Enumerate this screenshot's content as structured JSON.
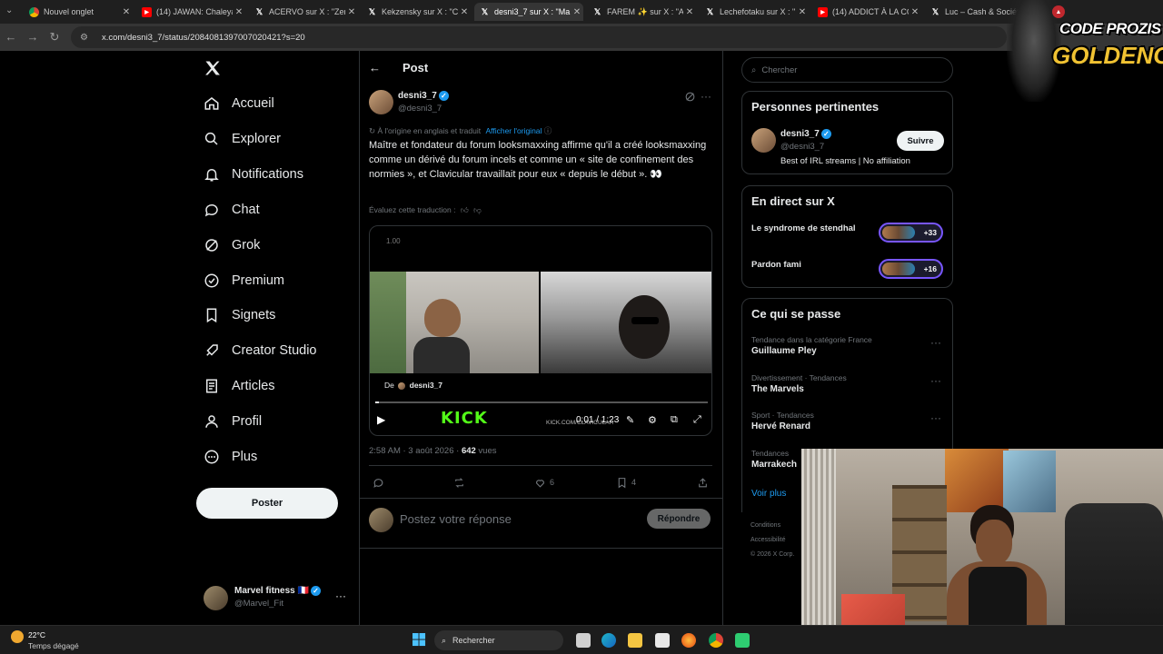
{
  "browser": {
    "tabs": [
      {
        "title": "Nouvel onglet",
        "icon": "chrome-icon",
        "active": false
      },
      {
        "title": "(14) JAWAN: Chaleya",
        "icon": "youtube-icon",
        "active": false
      },
      {
        "title": "ACERVO sur X : \"Zen",
        "icon": "x-icon",
        "active": false
      },
      {
        "title": "Kekzensky sur X : \"Cli",
        "icon": "x-icon",
        "active": false
      },
      {
        "title": "desni3_7 sur X : \"Ma",
        "icon": "x-icon",
        "active": true
      },
      {
        "title": "FAREM ✨ sur X : \"Aj",
        "icon": "x-icon",
        "active": false
      },
      {
        "title": "Lechefotaku sur X : \"",
        "icon": "x-icon",
        "active": false
      },
      {
        "title": "(14) ADDICT À LA CO",
        "icon": "youtube-icon",
        "active": false
      },
      {
        "title": "Luc – Cash & Sociét",
        "icon": "x-icon",
        "active": false
      }
    ],
    "url": "x.com/desni3_7/status/2084081397007020421?s=20"
  },
  "sidebar": {
    "items": [
      {
        "label": "Accueil",
        "icon": "home-icon"
      },
      {
        "label": "Explorer",
        "icon": "search-icon"
      },
      {
        "label": "Notifications",
        "icon": "bell-icon"
      },
      {
        "label": "Chat",
        "icon": "chat-bubble-icon"
      },
      {
        "label": "Grok",
        "icon": "grok-icon"
      },
      {
        "label": "Premium",
        "icon": "verified-badge-icon"
      },
      {
        "label": "Signets",
        "icon": "bookmark-icon"
      },
      {
        "label": "Creator Studio",
        "icon": "rocket-icon"
      },
      {
        "label": "Articles",
        "icon": "article-icon"
      },
      {
        "label": "Profil",
        "icon": "person-icon"
      },
      {
        "label": "Plus",
        "icon": "more-circle-icon"
      }
    ],
    "post_label": "Poster",
    "account": {
      "name": "Marvel fitness 🇫🇷",
      "handle": "@Marvel_Fit",
      "more": "···"
    }
  },
  "post": {
    "header": "Post",
    "author": {
      "name": "desni3_7",
      "handle": "@desni3_7"
    },
    "translated_note": "À l'origine en anglais et traduit",
    "show_original": "Afficher l'original",
    "text": "Maître et fondateur du forum looksmaxxing affirme qu'il a créé looksmaxxing comme un dérivé du forum incels et comme un « site de confinement des normies », et Clavicular travaillait pour eux « depuis le début ». 👀",
    "rate_translation": "Évaluez cette traduction :",
    "video": {
      "speed": "1.00",
      "from_label": "De",
      "from_user": "desni3_7",
      "time": "0:01 / 1:23",
      "kick": "KICK",
      "kick_url": "KICK.COM/CLAVICULAR",
      "progress": 0.01
    },
    "meta": {
      "time": "2:58 AM · 3 août 2026 · ",
      "views": "642",
      "views_label": " vues"
    },
    "actions": {
      "likes": "6",
      "bookmarks": "4"
    },
    "reply_placeholder": "Postez votre réponse",
    "reply_button": "Répondre"
  },
  "right": {
    "search_placeholder": "Chercher",
    "relevant": {
      "title": "Personnes pertinentes",
      "name": "desni3_7",
      "handle": "@desni3_7",
      "bio": "Best of IRL streams | No affiliation",
      "follow": "Suivre"
    },
    "live": {
      "title": "En direct sur X",
      "items": [
        {
          "title": "Le syndrome de stendhal",
          "count": "+33"
        },
        {
          "title": "Pardon fami",
          "count": "+16"
        }
      ]
    },
    "trends": {
      "title": "Ce qui se passe",
      "items": [
        {
          "category": "Tendance dans la catégorie France",
          "name": "Guillaume Pley"
        },
        {
          "category": "Divertissement · Tendances",
          "name": "The Marvels"
        },
        {
          "category": "Sport · Tendances",
          "name": "Hervé Renard"
        },
        {
          "category": "Tendances",
          "name": "Marrakech"
        }
      ],
      "show_more": "Voir plus"
    },
    "footer": [
      "Conditions",
      "Accessibilité",
      "© 2026 X Corp."
    ]
  },
  "overlay": {
    "logo_line1": "CODE PROZIS",
    "logo_line2": "GOLDENG"
  },
  "taskbar": {
    "temp": "22°C",
    "weather": "Temps dégagé",
    "search": "Rechercher"
  },
  "colors": {
    "accent": "#1d9bf0",
    "bg": "#000000",
    "border": "#2f3336",
    "live_ring": "#7856ff"
  }
}
